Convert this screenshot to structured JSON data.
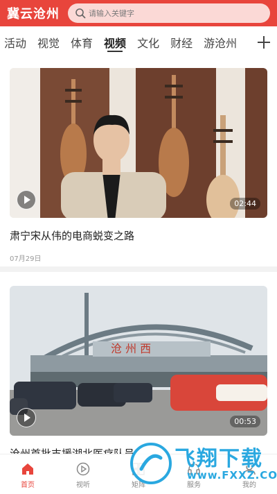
{
  "header": {
    "brand": "冀云沧州",
    "search_placeholder": "请输入关键字",
    "accent_color": "#e8453c"
  },
  "tabs": [
    {
      "label": "活动",
      "active": false
    },
    {
      "label": "视觉",
      "active": false
    },
    {
      "label": "体育",
      "active": false
    },
    {
      "label": "视频",
      "active": true
    },
    {
      "label": "文化",
      "active": false
    },
    {
      "label": "财经",
      "active": false
    },
    {
      "label": "游沧州",
      "active": false
    }
  ],
  "cards": [
    {
      "title": "肃宁宋从伟的电商蜕变之路",
      "date": "07月29日",
      "duration": "02:44"
    },
    {
      "title": "沧州首批支援湖北医疗队员",
      "date": "",
      "duration": "00:53"
    }
  ],
  "bottom_nav": [
    {
      "label": "首页",
      "icon": "home-icon",
      "active": true
    },
    {
      "label": "视听",
      "icon": "play-circle-icon",
      "active": false
    },
    {
      "label": "矩阵",
      "icon": "matrix-icon",
      "active": false
    },
    {
      "label": "服务",
      "icon": "service-icon",
      "active": false
    },
    {
      "label": "我的",
      "icon": "user-icon",
      "active": false
    }
  ],
  "watermark": {
    "text": "飞翔下载",
    "url": "www.FXXZ.COM"
  }
}
